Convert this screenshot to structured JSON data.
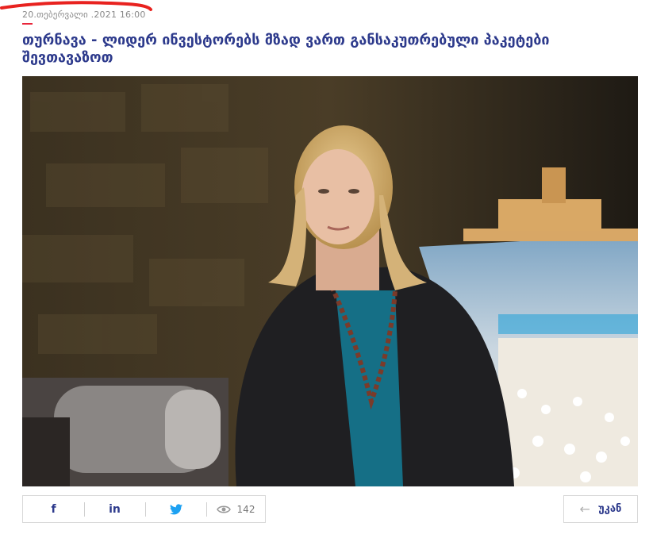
{
  "article": {
    "date": "20.თებერვალი .2021 16:00",
    "title": "თურნავა - ლიდერ ინვესტორებს მზად ვართ განსაკუთრებული პაკეტები შევთავაზოთ"
  },
  "share": {
    "facebook_label": "f",
    "linkedin_label": "in",
    "views_count": "142"
  },
  "back": {
    "label": "უკან"
  },
  "colors": {
    "title": "#2d3a8c",
    "accent": "#e8263a",
    "scribble": "#e8221f"
  },
  "icons": {
    "facebook": "facebook-icon",
    "linkedin": "linkedin-icon",
    "twitter": "twitter-icon",
    "views": "eye-icon",
    "back": "arrow-left-icon"
  }
}
